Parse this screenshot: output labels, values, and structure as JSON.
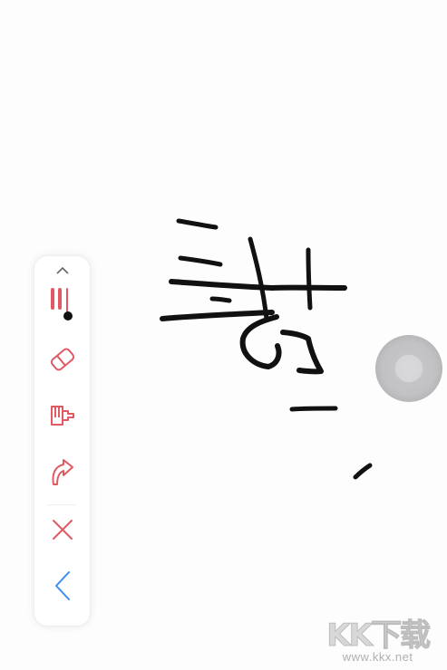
{
  "toolbar": {
    "collapse_icon": "chevron-up-icon",
    "tools": [
      {
        "name": "pen-tool",
        "icon": "pen-strokes-icon"
      },
      {
        "name": "eraser-tool",
        "icon": "eraser-icon"
      },
      {
        "name": "clear-brush-tool",
        "icon": "brush-icon"
      },
      {
        "name": "undo-tool",
        "icon": "curved-arrow-icon"
      },
      {
        "name": "close-tool",
        "icon": "close-icon"
      },
      {
        "name": "back-tool",
        "icon": "chevron-left-icon"
      }
    ],
    "accent_color": "#e05a64",
    "back_color": "#3d8ef0",
    "pen_dot_color": "#111111"
  },
  "canvas": {
    "ink_color": "#111111"
  },
  "floating_ball": {
    "color": "#c2c2c4"
  },
  "watermark": {
    "logo_text": "KK下载",
    "url": "www.kkx.net"
  }
}
